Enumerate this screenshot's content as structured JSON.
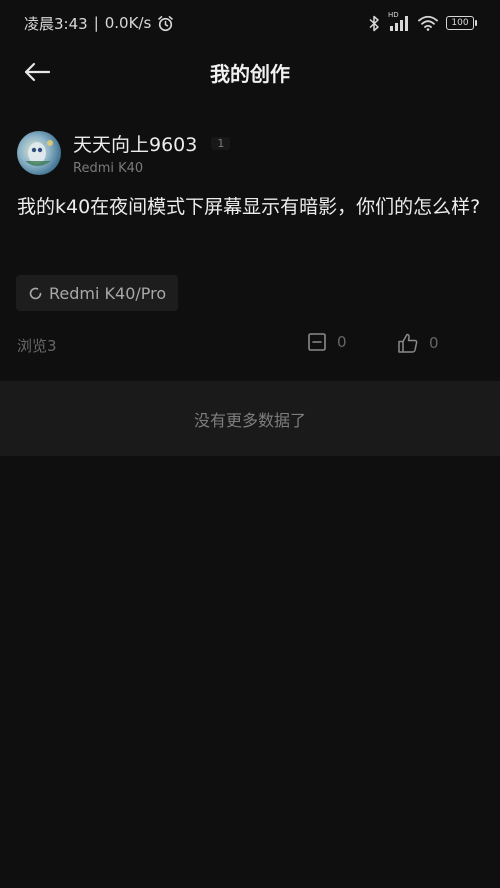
{
  "status_bar": {
    "time": "凌晨3:43",
    "separator": "|",
    "speed": "0.0K/s",
    "hd_label": "HD",
    "battery": "100",
    "icons": [
      "alarm-icon",
      "bluetooth-icon",
      "signal-icon",
      "wifi-icon",
      "battery-icon"
    ]
  },
  "header": {
    "title": "我的创作",
    "back_icon": "back-arrow-icon"
  },
  "post": {
    "author_name": "天天向上9603",
    "author_level": "1",
    "device": "Redmi K40",
    "text": "我的k40在夜间模式下屏幕显示有暗影，你们的怎么样?",
    "topic_tag": "Redmi K40/Pro",
    "views": "浏览3",
    "comment_count": "0",
    "like_count": "0"
  },
  "footer": {
    "no_more_text": "没有更多数据了"
  }
}
